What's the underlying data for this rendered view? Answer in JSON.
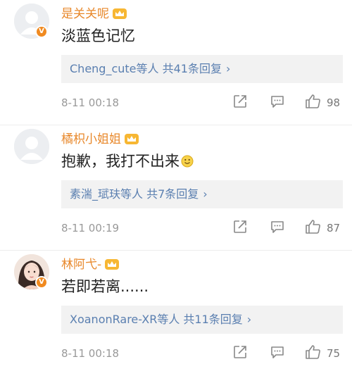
{
  "comments": [
    {
      "username": "是关关呢",
      "text": "淡蓝色记忆",
      "replies_users": "Cheng_cute等人",
      "replies_count": "共41条回复",
      "time": "8-11 00:18",
      "likes": "98",
      "avatar": "default-avatar",
      "verified": true
    },
    {
      "username": "橘枳小姐姐",
      "text": "抱歉，我打不出来",
      "replies_users": "素湍_珷玞等人",
      "replies_count": "共7条回复",
      "time": "8-11 00:19",
      "likes": "87",
      "avatar": "default-avatar",
      "verified": false
    },
    {
      "username": "林阿弋-",
      "text": "若即若离......",
      "replies_users": "XoanonRare-XR等人",
      "replies_count": "共11条回复",
      "time": "8-11 00:18",
      "likes": "75",
      "avatar": "photo-avatar",
      "verified": true
    }
  ],
  "icons": {
    "share": "share-icon",
    "comment": "comment-icon",
    "like": "thumbs-up-icon",
    "crown": "crown-icon",
    "arrow": "chevron-right-icon"
  },
  "colors": {
    "username": "#e8882b",
    "reply_link": "#5a7fb0",
    "meta": "#999999",
    "reply_bg": "#f2f2f2"
  }
}
